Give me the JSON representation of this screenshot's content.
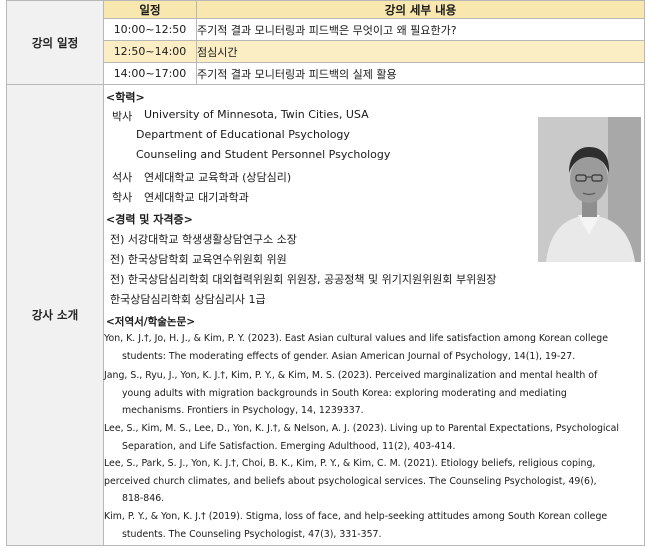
{
  "schedule": {
    "label": "강의 일정",
    "header": {
      "time": "일정",
      "detail": "강의 세부 내용"
    },
    "rows": [
      {
        "time": "10:00~12:50",
        "detail": "주기적 결과 모니터링과 피드백은 무엇이고 왜 필요한가?"
      },
      {
        "time": "12:50~14:00",
        "detail": "점심시간"
      },
      {
        "time": "14:00~17:00",
        "detail": "주기적 결과 모니터링과 피드백의 실제 활용"
      }
    ]
  },
  "instructor": {
    "label": "강사 소개",
    "education_title": "<학력>",
    "education": [
      {
        "degree": "박사",
        "lines": [
          "University of Minnesota, Twin Cities, USA",
          "Department of Educational Psychology",
          "Counseling and Student Personnel Psychology"
        ]
      },
      {
        "degree": "석사",
        "lines": [
          "연세대학교 교육학과 (상담심리)"
        ]
      },
      {
        "degree": "학사",
        "lines": [
          "연세대학교 대기과학과"
        ]
      }
    ],
    "career_title": "<경력 및 자격증>",
    "career": [
      "전) 서강대학교 학생생활상담연구소 소장",
      "전) 한국상담학회 교육연수위원회 위원",
      "전) 한국상담심리학회 대외협력위원회 위원장, 공공정책 및 위기지원위원회 부위원장",
      "한국상담심리학회 상담심리사 1급"
    ],
    "publications_title": "<저역서/학술논문>",
    "publications": [
      {
        "first": "Yon, K. J.†, Jo, H. J., & Kim, P. Y. (2023). East Asian cultural values and life satisfaction among Korean college",
        "rest": [
          "students: The moderating effects of gender. Asian American Journal of Psychology, 14(1), 19-27."
        ]
      },
      {
        "first": "Jang, S., Ryu, J., Yon, K. J.†, Kim, P. Y., & Kim, M. S. (2023). Perceived marginalization and mental health of",
        "rest": [
          "young adults with migration backgrounds in South Korea: exploring moderating and mediating",
          "mechanisms. Frontiers in Psychology, 14, 1239337."
        ]
      },
      {
        "first": "Lee, S., Kim, M. S., Lee, D., Yon, K. J.†, & Nelson, A. J. (2023). Living up to Parental Expectations, Psychological",
        "rest": [
          "Separation, and Life Satisfaction. Emerging Adulthood, 11(2), 403-414."
        ]
      },
      {
        "first": "Lee, S., Park, S. J., Yon, K. J.†, Choi, B. K., Kim, P. Y., & Kim, C. M. (2021). Etiology beliefs, religious coping,",
        "rest_noindent": "perceived church climates, and beliefs about psychological services. The Counseling Psychologist, 49(6),",
        "rest": [
          "818-846."
        ]
      },
      {
        "first": "Kim, P. Y., & Yon, K. J.† (2019). Stigma, loss of face, and help-seeking attitudes among South Korean college",
        "rest": [
          "students. The Counseling Psychologist, 47(3), 331-357."
        ]
      }
    ]
  }
}
